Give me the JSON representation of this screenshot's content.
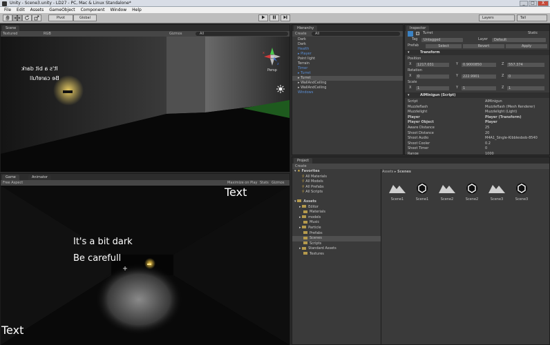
{
  "window": {
    "title": "Unity - Scene3.unity - LD27 - PC, Mac & Linux Standalone*",
    "controls": [
      "_",
      "□",
      "X"
    ]
  },
  "menu": [
    "File",
    "Edit",
    "Assets",
    "GameObject",
    "Component",
    "Window",
    "Help"
  ],
  "toolbar": {
    "tools": [
      "hand",
      "move",
      "rotate",
      "scale"
    ],
    "pivot": "Pivot",
    "global": "Global",
    "play_icons": [
      "play",
      "pause",
      "step"
    ],
    "layers": "Layers",
    "layout": "Tall"
  },
  "scene": {
    "tab": "Scene",
    "mode": "Textured",
    "color": "RGB",
    "gizmos": "Gizmos",
    "search": "All",
    "text_line1": "It's a bit dark",
    "text_line2": "Be carefull",
    "persp": "Persp",
    "axis_x": "x",
    "axis_z": "z"
  },
  "game": {
    "tabs": [
      "Game",
      "Animator"
    ],
    "aspect": "Free Aspect",
    "maximize": "Maximize on Play",
    "stats": "Stats",
    "gizmos": "Gizmos",
    "label_top": "Text",
    "label_bottom": "Text",
    "line1": "It's a bit dark",
    "line2": "Be carefull"
  },
  "hierarchy": {
    "tab": "Hierarchy",
    "create": "Create",
    "search": "All",
    "items": [
      {
        "label": "Dark",
        "style": "normal"
      },
      {
        "label": "Dark",
        "style": "normal"
      },
      {
        "label": "Health",
        "style": "blue"
      },
      {
        "label": "Player",
        "style": "blue"
      },
      {
        "label": "Point light",
        "style": "normal"
      },
      {
        "label": "Terrain",
        "style": "normal"
      },
      {
        "label": "Timer",
        "style": "blue"
      },
      {
        "label": "Turret",
        "style": "blue"
      },
      {
        "label": "Turret",
        "style": "selected"
      },
      {
        "label": "WallAndCeiling",
        "style": "normal"
      },
      {
        "label": "WallAndCeiling",
        "style": "normal"
      },
      {
        "label": "Windows",
        "style": "blue"
      }
    ]
  },
  "inspector": {
    "tab": "Inspector",
    "object_name": "Turret",
    "static": "Static",
    "tag_label": "Tag",
    "tag_value": "Untagged",
    "layer_label": "Layer",
    "layer_value": "Default",
    "prefab_label": "Prefab",
    "prefab_select": "Select",
    "prefab_revert": "Revert",
    "prefab_apply": "Apply",
    "transform": {
      "title": "Transform",
      "position": "Position",
      "rotation": "Rotation",
      "scale": "Scale",
      "pos": {
        "x": "1217.031",
        "y": "0.9000850",
        "z": "557.374"
      },
      "rot": {
        "x": "0",
        "y": "222.9901",
        "z": "0"
      },
      "scl": {
        "x": "1",
        "y": "1",
        "z": "1"
      }
    },
    "script": {
      "title": "AIMinigun (Script)",
      "rows": [
        {
          "k": "Script",
          "v": "AIMinigun",
          "bold": false
        },
        {
          "k": "Muzzleflash",
          "v": "Muzzleflash (Mesh Renderer)",
          "bold": false
        },
        {
          "k": "Muzzlelight",
          "v": "Muzzlelight (Light)",
          "bold": false
        },
        {
          "k": "Player",
          "v": "Player (Transform)",
          "bold": true
        },
        {
          "k": "Player Object",
          "v": "Player",
          "bold": true
        },
        {
          "k": "Aware Distance",
          "v": "25",
          "bold": false
        },
        {
          "k": "Shoot Distance",
          "v": "20",
          "bold": false
        },
        {
          "k": "Shoot Audio",
          "v": "M4A1_Single-Kibblesbob-8540",
          "bold": false
        },
        {
          "k": "Shoot Cooler",
          "v": "0.2",
          "bold": false
        },
        {
          "k": "Shoot Timer",
          "v": "0",
          "bold": false
        },
        {
          "k": "Range",
          "v": "1000",
          "bold": false
        }
      ]
    }
  },
  "project": {
    "tab": "Project",
    "create": "Create",
    "favorites": "Favorites",
    "fav_items": [
      "All Materials",
      "All Models",
      "All Prefabs",
      "All Scripts"
    ],
    "assets": "Assets",
    "folders": [
      "Editor",
      "Materials",
      "models",
      "Music",
      "Particle",
      "Prefabs",
      "Scenes",
      "Scripts",
      "Standard Assets",
      "Textures"
    ],
    "breadcrumb": "Assets",
    "breadcrumb_current": "Scenes",
    "scenes": [
      "Scene1",
      "Scene1",
      "Scene2",
      "Scene2",
      "Scene3",
      "Scene3"
    ]
  },
  "colors": {
    "selection": "#4f4f4f",
    "blue_prefab": "#5b8fd6",
    "panel": "#3a3a3a"
  }
}
